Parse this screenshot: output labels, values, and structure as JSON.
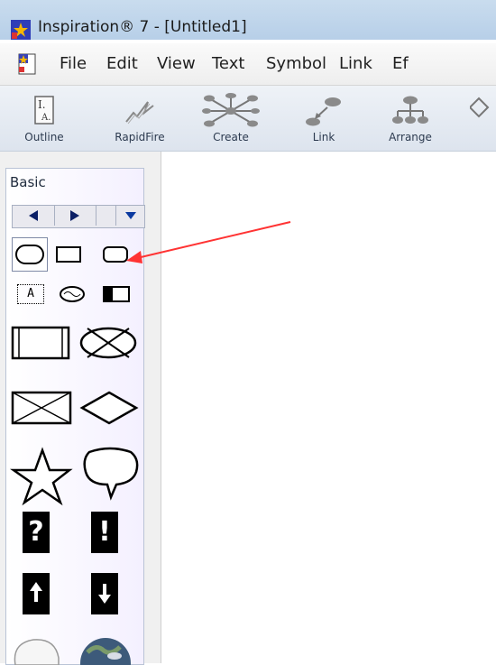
{
  "window": {
    "title": "Inspiration® 7 - [Untitled1]"
  },
  "menu": {
    "items": [
      "File",
      "Edit",
      "View",
      "Text",
      "Symbol",
      "Link",
      "Ef"
    ]
  },
  "toolbar": {
    "buttons": [
      {
        "label": "Outline",
        "icon": "outline-icon"
      },
      {
        "label": "RapidFire",
        "icon": "rapidfire-icon"
      },
      {
        "label": "Create",
        "icon": "create-icon"
      },
      {
        "label": "Link",
        "icon": "link-icon"
      },
      {
        "label": "Arrange",
        "icon": "arrange-icon"
      }
    ]
  },
  "palette": {
    "title": "Basic",
    "symbols": [
      "rounded-oval-shape",
      "rectangle-shape",
      "rounded-rectangle-shape",
      "text-box-shape",
      "cloud-oval-shape",
      "half-filled-rectangle-shape",
      "double-rectangle-shape",
      "crossed-oval-shape",
      "crossed-rectangle-shape",
      "diamond-shape",
      "star-shape",
      "speech-bubble-shape",
      "question-mark-shape",
      "exclamation-mark-shape",
      "up-arrow-shape",
      "down-arrow-shape",
      "white-blob-shape",
      "earth-globe-shape"
    ],
    "text_box_glyph": "A",
    "question_glyph": "?",
    "exclamation_glyph": "!"
  },
  "annotation": {
    "arrow_color": "#ff3333"
  }
}
